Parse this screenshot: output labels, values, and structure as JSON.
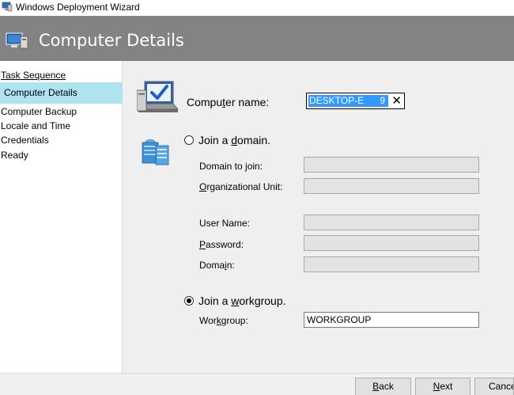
{
  "window": {
    "title": "Windows Deployment Wizard"
  },
  "header": {
    "title": "Computer Details"
  },
  "sidebar": {
    "items": [
      {
        "label": "Task Sequence",
        "state": "completed"
      },
      {
        "label": "Computer Details",
        "state": "active"
      },
      {
        "label": "Computer Backup",
        "state": "pending"
      },
      {
        "label": "Locale and Time",
        "state": "pending"
      },
      {
        "label": "Credentials",
        "state": "pending"
      },
      {
        "label": "Ready",
        "state": "pending"
      }
    ]
  },
  "form": {
    "computer_name": {
      "label_pre": "Compu",
      "label_ul": "t",
      "label_post": "er name:",
      "value_start": "DESKTOP-E",
      "value_end": "9"
    },
    "domain_option": {
      "label_pre": "Join a ",
      "label_ul": "d",
      "label_post": "omain.",
      "selected": false
    },
    "domain_fields": [
      {
        "label_pre": "Domain to join:",
        "label_ul": "",
        "label_post": "",
        "value": ""
      },
      {
        "label_pre": "",
        "label_ul": "O",
        "label_post": "rganizational Unit:",
        "value": ""
      },
      {
        "label_pre": "User Name:",
        "label_ul": "",
        "label_post": "",
        "value": ""
      },
      {
        "label_pre": "",
        "label_ul": "P",
        "label_post": "assword:",
        "value": ""
      },
      {
        "label_pre": "Doma",
        "label_ul": "i",
        "label_post": "n:",
        "value": ""
      }
    ],
    "workgroup_option": {
      "label_pre": "Join a ",
      "label_ul": "w",
      "label_post": "orkgroup.",
      "selected": true
    },
    "workgroup_field": {
      "label_pre": "Wor",
      "label_ul": "k",
      "label_post": "group:",
      "value": "WORKGROUP"
    }
  },
  "buttons": {
    "back_ul": "B",
    "back_rest": "ack",
    "next_ul": "N",
    "next_rest": "ext",
    "cancel_pre": "Cance",
    "cancel_post": ""
  },
  "colors": {
    "header_bg": "#838383",
    "active_nav_bg": "#aee4f0",
    "main_bg": "#efefef",
    "selection": "#3399ff"
  },
  "icons": {
    "titlebar": "wizard-computer-icon",
    "header": "computer-icon",
    "computer_name": "computer-checkmark-icon",
    "domain": "server-network-icon"
  }
}
